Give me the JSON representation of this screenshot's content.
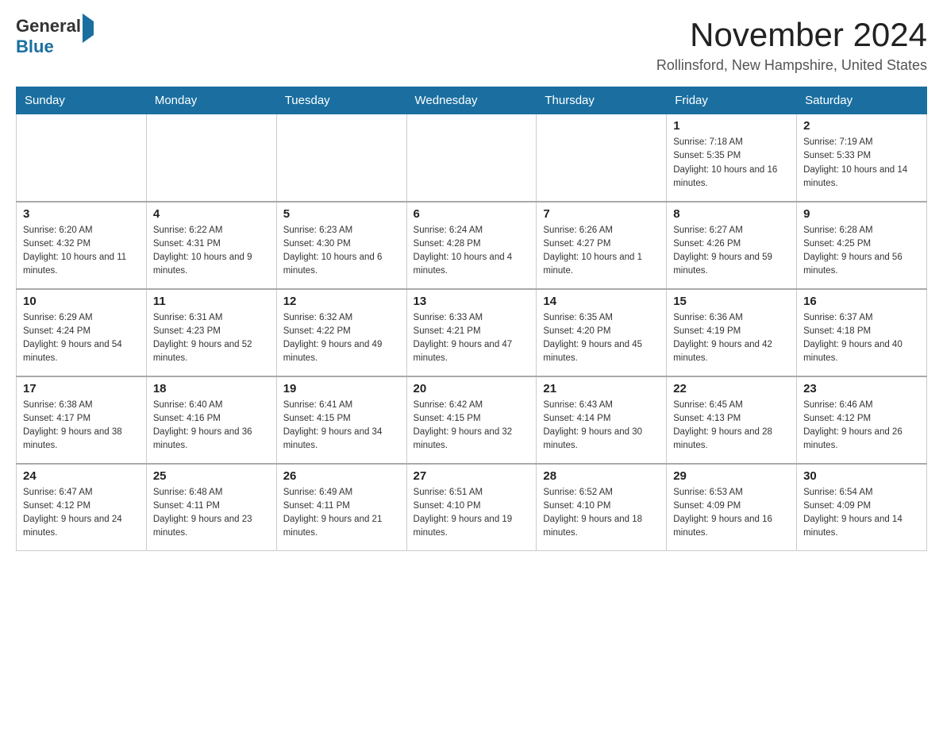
{
  "header": {
    "logo_general": "General",
    "logo_blue": "Blue",
    "title": "November 2024",
    "subtitle": "Rollinsford, New Hampshire, United States"
  },
  "weekdays": [
    "Sunday",
    "Monday",
    "Tuesday",
    "Wednesday",
    "Thursday",
    "Friday",
    "Saturday"
  ],
  "weeks": [
    [
      {
        "day": "",
        "sunrise": "",
        "sunset": "",
        "daylight": ""
      },
      {
        "day": "",
        "sunrise": "",
        "sunset": "",
        "daylight": ""
      },
      {
        "day": "",
        "sunrise": "",
        "sunset": "",
        "daylight": ""
      },
      {
        "day": "",
        "sunrise": "",
        "sunset": "",
        "daylight": ""
      },
      {
        "day": "",
        "sunrise": "",
        "sunset": "",
        "daylight": ""
      },
      {
        "day": "1",
        "sunrise": "Sunrise: 7:18 AM",
        "sunset": "Sunset: 5:35 PM",
        "daylight": "Daylight: 10 hours and 16 minutes."
      },
      {
        "day": "2",
        "sunrise": "Sunrise: 7:19 AM",
        "sunset": "Sunset: 5:33 PM",
        "daylight": "Daylight: 10 hours and 14 minutes."
      }
    ],
    [
      {
        "day": "3",
        "sunrise": "Sunrise: 6:20 AM",
        "sunset": "Sunset: 4:32 PM",
        "daylight": "Daylight: 10 hours and 11 minutes."
      },
      {
        "day": "4",
        "sunrise": "Sunrise: 6:22 AM",
        "sunset": "Sunset: 4:31 PM",
        "daylight": "Daylight: 10 hours and 9 minutes."
      },
      {
        "day": "5",
        "sunrise": "Sunrise: 6:23 AM",
        "sunset": "Sunset: 4:30 PM",
        "daylight": "Daylight: 10 hours and 6 minutes."
      },
      {
        "day": "6",
        "sunrise": "Sunrise: 6:24 AM",
        "sunset": "Sunset: 4:28 PM",
        "daylight": "Daylight: 10 hours and 4 minutes."
      },
      {
        "day": "7",
        "sunrise": "Sunrise: 6:26 AM",
        "sunset": "Sunset: 4:27 PM",
        "daylight": "Daylight: 10 hours and 1 minute."
      },
      {
        "day": "8",
        "sunrise": "Sunrise: 6:27 AM",
        "sunset": "Sunset: 4:26 PM",
        "daylight": "Daylight: 9 hours and 59 minutes."
      },
      {
        "day": "9",
        "sunrise": "Sunrise: 6:28 AM",
        "sunset": "Sunset: 4:25 PM",
        "daylight": "Daylight: 9 hours and 56 minutes."
      }
    ],
    [
      {
        "day": "10",
        "sunrise": "Sunrise: 6:29 AM",
        "sunset": "Sunset: 4:24 PM",
        "daylight": "Daylight: 9 hours and 54 minutes."
      },
      {
        "day": "11",
        "sunrise": "Sunrise: 6:31 AM",
        "sunset": "Sunset: 4:23 PM",
        "daylight": "Daylight: 9 hours and 52 minutes."
      },
      {
        "day": "12",
        "sunrise": "Sunrise: 6:32 AM",
        "sunset": "Sunset: 4:22 PM",
        "daylight": "Daylight: 9 hours and 49 minutes."
      },
      {
        "day": "13",
        "sunrise": "Sunrise: 6:33 AM",
        "sunset": "Sunset: 4:21 PM",
        "daylight": "Daylight: 9 hours and 47 minutes."
      },
      {
        "day": "14",
        "sunrise": "Sunrise: 6:35 AM",
        "sunset": "Sunset: 4:20 PM",
        "daylight": "Daylight: 9 hours and 45 minutes."
      },
      {
        "day": "15",
        "sunrise": "Sunrise: 6:36 AM",
        "sunset": "Sunset: 4:19 PM",
        "daylight": "Daylight: 9 hours and 42 minutes."
      },
      {
        "day": "16",
        "sunrise": "Sunrise: 6:37 AM",
        "sunset": "Sunset: 4:18 PM",
        "daylight": "Daylight: 9 hours and 40 minutes."
      }
    ],
    [
      {
        "day": "17",
        "sunrise": "Sunrise: 6:38 AM",
        "sunset": "Sunset: 4:17 PM",
        "daylight": "Daylight: 9 hours and 38 minutes."
      },
      {
        "day": "18",
        "sunrise": "Sunrise: 6:40 AM",
        "sunset": "Sunset: 4:16 PM",
        "daylight": "Daylight: 9 hours and 36 minutes."
      },
      {
        "day": "19",
        "sunrise": "Sunrise: 6:41 AM",
        "sunset": "Sunset: 4:15 PM",
        "daylight": "Daylight: 9 hours and 34 minutes."
      },
      {
        "day": "20",
        "sunrise": "Sunrise: 6:42 AM",
        "sunset": "Sunset: 4:15 PM",
        "daylight": "Daylight: 9 hours and 32 minutes."
      },
      {
        "day": "21",
        "sunrise": "Sunrise: 6:43 AM",
        "sunset": "Sunset: 4:14 PM",
        "daylight": "Daylight: 9 hours and 30 minutes."
      },
      {
        "day": "22",
        "sunrise": "Sunrise: 6:45 AM",
        "sunset": "Sunset: 4:13 PM",
        "daylight": "Daylight: 9 hours and 28 minutes."
      },
      {
        "day": "23",
        "sunrise": "Sunrise: 6:46 AM",
        "sunset": "Sunset: 4:12 PM",
        "daylight": "Daylight: 9 hours and 26 minutes."
      }
    ],
    [
      {
        "day": "24",
        "sunrise": "Sunrise: 6:47 AM",
        "sunset": "Sunset: 4:12 PM",
        "daylight": "Daylight: 9 hours and 24 minutes."
      },
      {
        "day": "25",
        "sunrise": "Sunrise: 6:48 AM",
        "sunset": "Sunset: 4:11 PM",
        "daylight": "Daylight: 9 hours and 23 minutes."
      },
      {
        "day": "26",
        "sunrise": "Sunrise: 6:49 AM",
        "sunset": "Sunset: 4:11 PM",
        "daylight": "Daylight: 9 hours and 21 minutes."
      },
      {
        "day": "27",
        "sunrise": "Sunrise: 6:51 AM",
        "sunset": "Sunset: 4:10 PM",
        "daylight": "Daylight: 9 hours and 19 minutes."
      },
      {
        "day": "28",
        "sunrise": "Sunrise: 6:52 AM",
        "sunset": "Sunset: 4:10 PM",
        "daylight": "Daylight: 9 hours and 18 minutes."
      },
      {
        "day": "29",
        "sunrise": "Sunrise: 6:53 AM",
        "sunset": "Sunset: 4:09 PM",
        "daylight": "Daylight: 9 hours and 16 minutes."
      },
      {
        "day": "30",
        "sunrise": "Sunrise: 6:54 AM",
        "sunset": "Sunset: 4:09 PM",
        "daylight": "Daylight: 9 hours and 14 minutes."
      }
    ]
  ]
}
